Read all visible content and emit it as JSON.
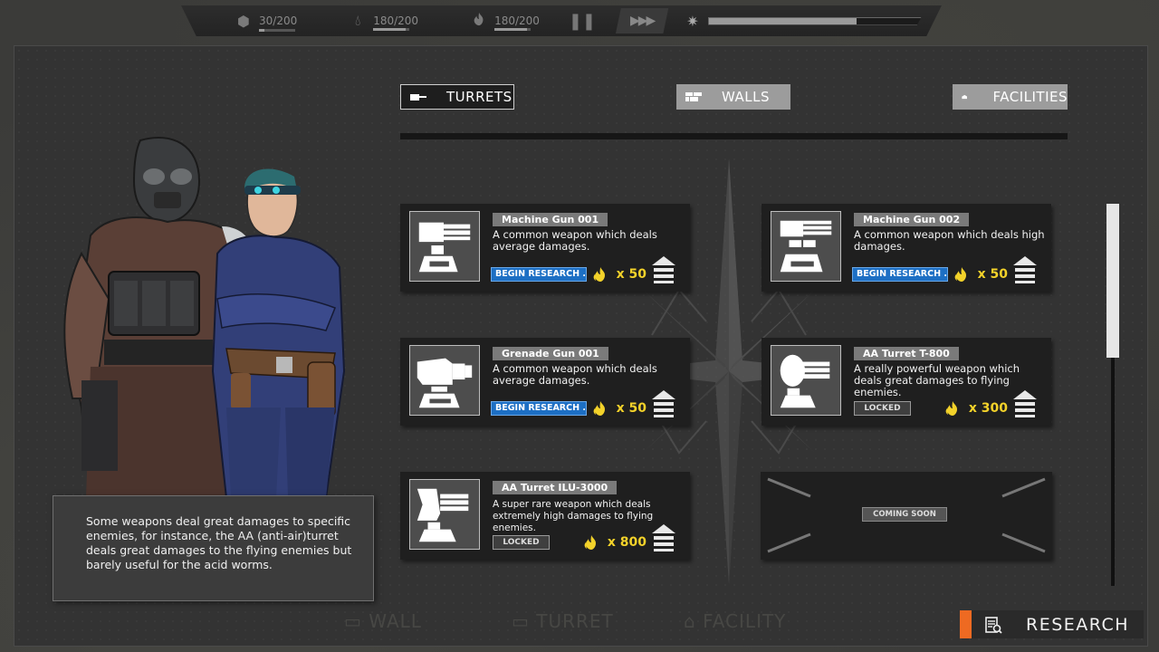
{
  "topbar": {
    "resources": [
      {
        "icon": "hexagon-icon",
        "text": "30/200",
        "fill": 0.15
      },
      {
        "icon": "water-drop-icon",
        "text": "180/200",
        "fill": 0.9
      },
      {
        "icon": "flame-icon",
        "text": "180/200",
        "fill": 0.9
      }
    ],
    "day_progress": 0.7
  },
  "tabs": {
    "turrets": "TURRETS",
    "walls": "WALLS",
    "facilities": "FACILITIES",
    "active": "turrets"
  },
  "info_text": "Some weapons deal great damages to specific enemies, for instance, the AA (anti-air)turret deals great damages to the flying enemies but barely useful for the acid worms.",
  "cards": [
    {
      "name": "Machine Gun 001",
      "desc": "A common weapon which deals average damages.",
      "status": "BEGIN RESEARCH ...",
      "cost": "x 50"
    },
    {
      "name": "Machine Gun 002",
      "desc": "A common weapon which deals high damages.",
      "status": "BEGIN RESEARCH ...",
      "cost": "x 50"
    },
    {
      "name": "Grenade Gun 001",
      "desc": "A common weapon which deals average damages.",
      "status": "BEGIN RESEARCH ...",
      "cost": "x 50"
    },
    {
      "name": "AA Turret T-800",
      "desc": "A really powerful weapon which deals great damages to flying enemies.",
      "status": "LOCKED",
      "cost": "x 300"
    },
    {
      "name": "AA Turret ILU-3000",
      "desc": "A super rare weapon which deals extremely high damages to flying enemies.",
      "status": "LOCKED",
      "cost": "x 800"
    }
  ],
  "coming_soon": "COMING SOON",
  "ghost_labels": {
    "wall": "WALL",
    "turret": "TURRET",
    "facility": "FACILITY"
  },
  "research_button": "RESEARCH",
  "colors": {
    "accent": "#ee6a22",
    "research_blue": "#1d6fc4",
    "cost_yellow": "#f3d22a"
  }
}
